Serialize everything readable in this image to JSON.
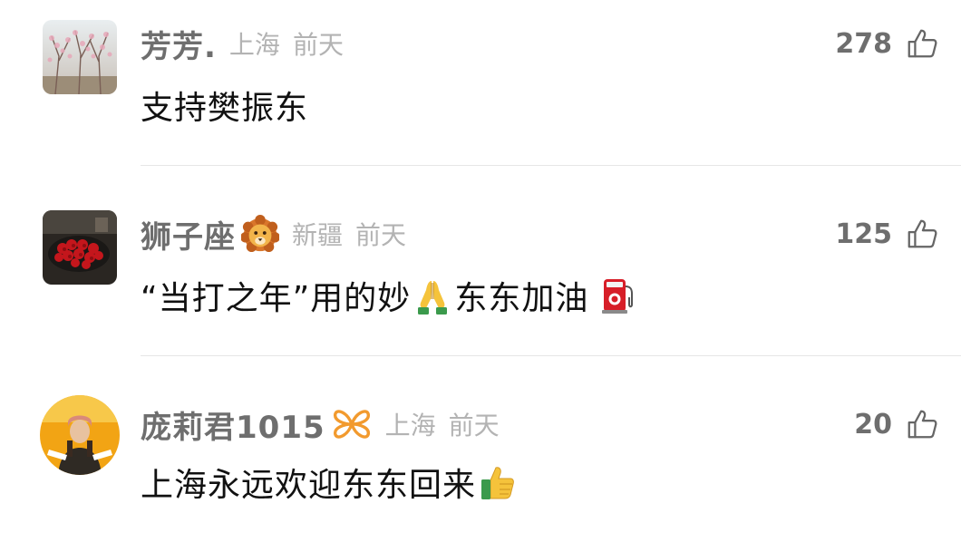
{
  "comments": [
    {
      "username": "芳芳.",
      "location": "上海",
      "time": "前天",
      "likes": "278",
      "text_parts": [
        "支持樊振东"
      ],
      "avatar_icon": "peach-blossom-photo",
      "liked": false
    },
    {
      "username": "狮子座",
      "username_badge_icon": "lion-face-emoji",
      "location": "新疆",
      "time": "前天",
      "likes": "125",
      "text_parts": [
        "“当打之年”用的妙",
        "东东加油"
      ],
      "inline_icons": [
        "folded-hands-emoji",
        "fuel-pump-emoji"
      ],
      "avatar_icon": "red-roses-bouquet-photo",
      "liked": false
    },
    {
      "username": "庞莉君1015",
      "username_badge_icon": "orange-butterfly-badge",
      "location": "上海",
      "time": "前天",
      "likes": "20",
      "text_parts": [
        "上海永远欢迎东东回来"
      ],
      "inline_icons": [
        "thumbs-up-emoji"
      ],
      "avatar_icon": "person-portrait-photo",
      "liked": false
    }
  ],
  "colors": {
    "username": "#6e6e6e",
    "meta": "#b3b3b3",
    "text": "#111111",
    "divider": "#e6e6e6"
  }
}
